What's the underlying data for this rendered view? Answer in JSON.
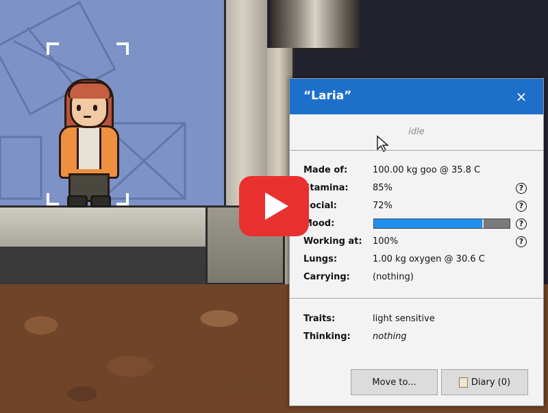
{
  "panel": {
    "title": "“Laria”",
    "close_icon": "×",
    "status": "idle",
    "stats": [
      {
        "label": "Made of:",
        "value": "100.00 kg goo @ 35.8 C"
      },
      {
        "label": "Stamina:",
        "value": "85%"
      },
      {
        "label": "Social:",
        "value": "72%"
      },
      {
        "label": "Mood:",
        "value": ""
      },
      {
        "label": "Working at:",
        "value": "100%"
      },
      {
        "label": "Lungs:",
        "value": "1.00 kg oxygen @ 30.6 C"
      },
      {
        "label": "Carrying:",
        "value": "(nothing)"
      }
    ],
    "mood_level": 0.81,
    "help_icon": "?",
    "traits_label": "Traits:",
    "traits_value": "light sensitive",
    "thinking_label": "Thinking:",
    "thinking_value": "nothing",
    "move_button": "Move to...",
    "diary_button": "Diary (0)"
  },
  "colors": {
    "header": "#1e6fc9",
    "mood_fill": "#1f8ff0",
    "play_button": "#e8312f"
  },
  "icons": {
    "play": "play-icon",
    "cursor": "cursor-icon",
    "diary": "diary-icon",
    "help": "help-icon",
    "close": "close-icon"
  }
}
